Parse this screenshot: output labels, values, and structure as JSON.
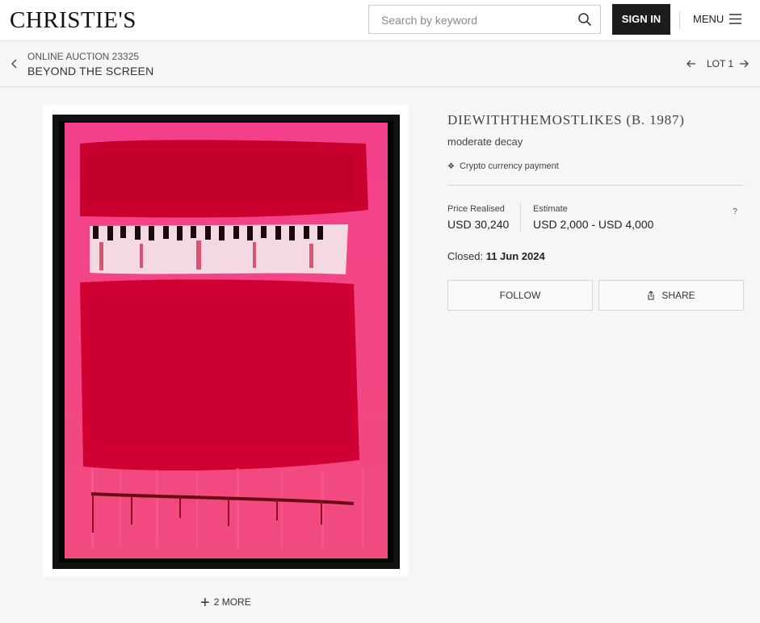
{
  "header": {
    "logo": "CHRISTIE'S",
    "search_placeholder": "Search by keyword",
    "sign_in_label": "SIGN IN",
    "menu_label": "MENU"
  },
  "subheader": {
    "auction_line": "ONLINE AUCTION 23325",
    "auction_title": "BEYOND THE SCREEN",
    "lot_label": "LOT 1"
  },
  "gallery": {
    "more_label": "2 MORE"
  },
  "lot": {
    "artist": "DIEWITHTHEMOSTLIKES (B. 1987)",
    "title": "moderate decay",
    "crypto_label": "Crypto currency payment",
    "price_realised_label": "Price Realised",
    "price_realised_value": "USD 30,240",
    "estimate_label": "Estimate",
    "estimate_value": "USD 2,000 - USD 4,000",
    "help_label": "?",
    "closed_label": "Closed:",
    "closed_date": "11 Jun 2024",
    "follow_label": "FOLLOW",
    "share_label": "SHARE"
  },
  "colors": {
    "brand_dark": "#1c1c1c",
    "canvas_pink": "#f0457f",
    "block_red": "#c8002b"
  }
}
